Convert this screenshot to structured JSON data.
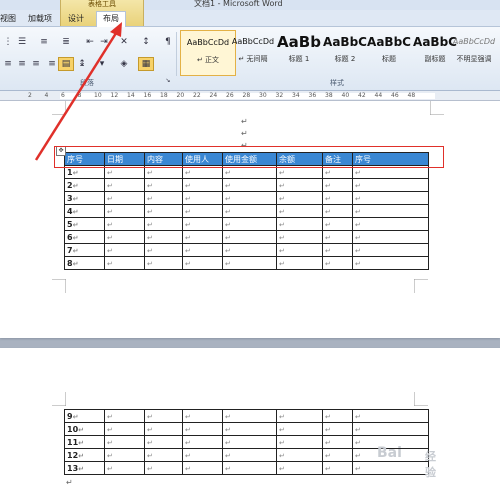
{
  "window": {
    "title": "文档1 - Microsoft Word"
  },
  "context_group": {
    "label": "表格工具"
  },
  "tabs": {
    "view": "视图",
    "addins": "加载项",
    "design": "设计",
    "layout": "布局"
  },
  "ribbon": {
    "paragraph_label": "段落",
    "styles_label": "样式",
    "styles": [
      {
        "sample": "AaBbCcDd",
        "name": "↵ 正文"
      },
      {
        "sample": "AaBbCcDd",
        "name": "↵ 无间隔"
      },
      {
        "sample": "AaBb",
        "name": "标题 1"
      },
      {
        "sample": "AaBbC",
        "name": "标题 2"
      },
      {
        "sample": "AaBbC",
        "name": "标题"
      },
      {
        "sample": "AaBbC",
        "name": "副标题"
      },
      {
        "sample": "AaBbCcDd",
        "name": "不明显强调"
      }
    ],
    "highlight_color": "#f7d26a"
  },
  "ruler": {
    "numbers": [
      "2",
      "4",
      "6",
      "8",
      "10",
      "12",
      "14",
      "16",
      "18",
      "20",
      "22",
      "24",
      "26",
      "28",
      "30",
      "32",
      "34",
      "36",
      "38",
      "40",
      "42",
      "44",
      "46",
      "48"
    ]
  },
  "pilcrow": "↵",
  "table": {
    "header": [
      "序号",
      "日期",
      "内容",
      "使用人",
      "使用金额",
      "余额",
      "备注",
      "序号"
    ],
    "rows_page1": [
      "1",
      "2",
      "3",
      "4",
      "5",
      "6",
      "7",
      "8"
    ],
    "rows_page2": [
      "9",
      "10",
      "11",
      "12",
      "13"
    ]
  },
  "colors": {
    "header_fill": "#3a87d3",
    "annotation_red": "#e0302a"
  },
  "watermark": {
    "text": "Bai",
    "sub": "经验"
  }
}
